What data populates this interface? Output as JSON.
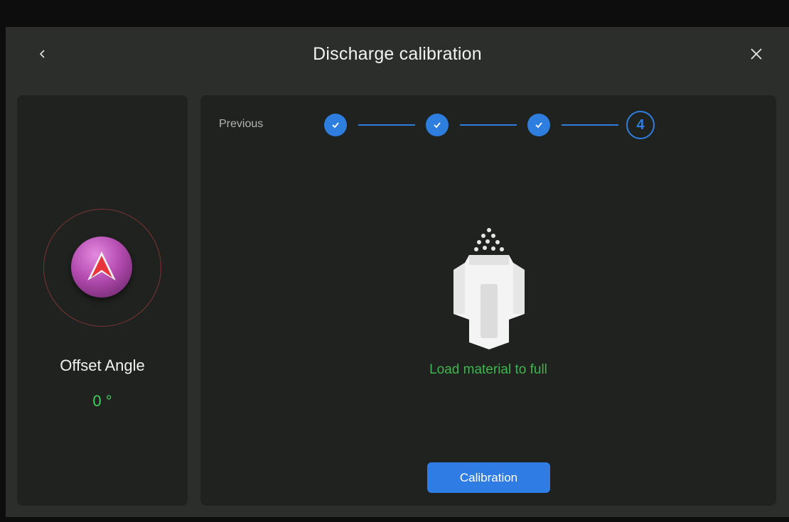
{
  "header": {
    "title": "Discharge calibration",
    "back_icon": "chevron-left-icon",
    "close_icon": "close-icon"
  },
  "left_panel": {
    "offset_label": "Offset Angle",
    "offset_value": "0 °",
    "compass_icon": "compass-arrow-icon"
  },
  "main": {
    "previous_label": "Previous",
    "steps": [
      {
        "state": "done",
        "icon": "check-icon"
      },
      {
        "state": "done",
        "icon": "check-icon"
      },
      {
        "state": "done",
        "icon": "check-icon"
      },
      {
        "state": "current",
        "label": "4"
      }
    ],
    "instruction": "Load material to full",
    "calibration_button": "Calibration"
  },
  "colors": {
    "accent_blue": "#2e7ee0",
    "status_green": "#3fb54e",
    "value_green": "#3fd05b"
  }
}
